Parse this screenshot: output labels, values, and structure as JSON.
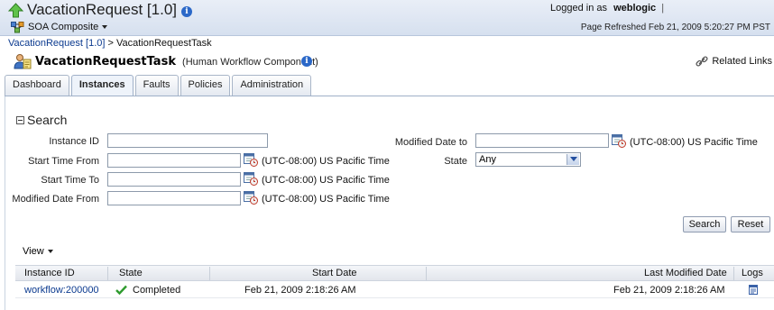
{
  "header": {
    "app_title": "VacationRequest [1.0]",
    "composite_menu": "SOA Composite",
    "logged_in_label": "Logged in as",
    "user": "weblogic",
    "user_sep": "|",
    "page_refreshed": "Page Refreshed Feb 21, 2009 5:20:27 PM PST"
  },
  "breadcrumb": {
    "link": "VacationRequest [1.0]",
    "separator": ">",
    "current": "VacationRequestTask"
  },
  "component": {
    "name": "VacationRequestTask",
    "type": "(Human Workflow Component)",
    "related_links": "Related Links"
  },
  "tabs": [
    {
      "label": "Dashboard",
      "active": false
    },
    {
      "label": "Instances",
      "active": true
    },
    {
      "label": "Faults",
      "active": false
    },
    {
      "label": "Policies",
      "active": false
    },
    {
      "label": "Administration",
      "active": false
    }
  ],
  "search": {
    "title": "Search",
    "instance_id_label": "Instance ID",
    "instance_id_value": "",
    "start_from_label": "Start Time From",
    "start_from_value": "",
    "start_to_label": "Start Time To",
    "start_to_value": "",
    "modified_from_label": "Modified Date From",
    "modified_from_value": "",
    "modified_to_label": "Modified Date to",
    "modified_to_value": "",
    "state_label": "State",
    "state_value": "Any",
    "timezone": "(UTC-08:00) US Pacific Time",
    "search_button": "Search",
    "reset_button": "Reset"
  },
  "table": {
    "view_menu": "View",
    "columns": [
      "Instance ID",
      "State",
      "Start Date",
      "Last Modified Date",
      "Logs"
    ],
    "rows": [
      {
        "instance_id": "workflow:200000",
        "state": "Completed",
        "start_date": "Feb 21, 2009 2:18:26 AM",
        "last_modified": "Feb 21, 2009 2:18:26 AM"
      }
    ]
  },
  "colors": {
    "link": "#0b3a8f",
    "header_bg": "#d6e0ef",
    "accent": "#2b68c8",
    "success": "#2e9b2e"
  }
}
